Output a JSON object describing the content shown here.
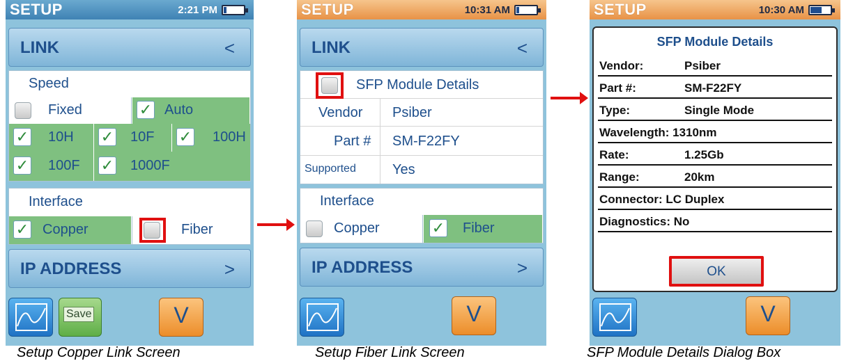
{
  "screen1": {
    "header": {
      "title": "SETUP",
      "time": "2:21 PM"
    },
    "link_bar": {
      "label": "LINK",
      "arrow": "<"
    },
    "speed": {
      "title": "Speed",
      "fixed": "Fixed",
      "auto": "Auto",
      "options": [
        "10H",
        "10F",
        "100H",
        "100F",
        "1000F"
      ]
    },
    "interface": {
      "title": "Interface",
      "copper": "Copper",
      "fiber": "Fiber"
    },
    "ip_bar": {
      "label": "IP ADDRESS",
      "arrow": ">"
    },
    "toolbar": {
      "save": "Save",
      "down": "V"
    },
    "caption": "Setup Copper Link Screen"
  },
  "screen2": {
    "header": {
      "title": "SETUP",
      "time": "10:31 AM"
    },
    "link_bar": {
      "label": "LINK",
      "arrow": "<"
    },
    "sfp": {
      "title": "SFP Module Details",
      "vendor_label": "Vendor",
      "vendor_value": "Psiber",
      "part_label": "Part #",
      "part_value": "SM-F22FY",
      "supported_label": "Supported",
      "supported_value": "Yes"
    },
    "interface": {
      "title": "Interface",
      "copper": "Copper",
      "fiber": "Fiber"
    },
    "ip_bar": {
      "label": "IP ADDRESS",
      "arrow": ">"
    },
    "toolbar": {
      "down": "V"
    },
    "caption": "Setup Fiber Link Screen"
  },
  "screen3": {
    "header": {
      "title": "SETUP",
      "time": "10:30 AM"
    },
    "dialog": {
      "title": "SFP Module Details",
      "rows": [
        {
          "key": "Vendor:",
          "value": "Psiber"
        },
        {
          "key": "Part #:",
          "value": "SM-F22FY"
        },
        {
          "key": "Type:",
          "value": "Single Mode"
        },
        {
          "key": "Wavelength: 1310nm",
          "value": ""
        },
        {
          "key": "Rate:",
          "value": "1.25Gb"
        },
        {
          "key": "Range:",
          "value": "20km"
        },
        {
          "key": "Connector: LC Duplex",
          "value": ""
        },
        {
          "key": "Diagnostics: No",
          "value": ""
        }
      ],
      "ok": "OK"
    },
    "toolbar": {
      "down": "V"
    },
    "caption": "SFP Module Details Dialog Box"
  },
  "colors": {
    "accent_red": "#e01010",
    "check_green": "#7fc080",
    "screen_bg": "#8ec3dc"
  },
  "icons": [
    "graph-icon",
    "battery-icon",
    "checkmark-icon",
    "arrow-right-icon"
  ]
}
